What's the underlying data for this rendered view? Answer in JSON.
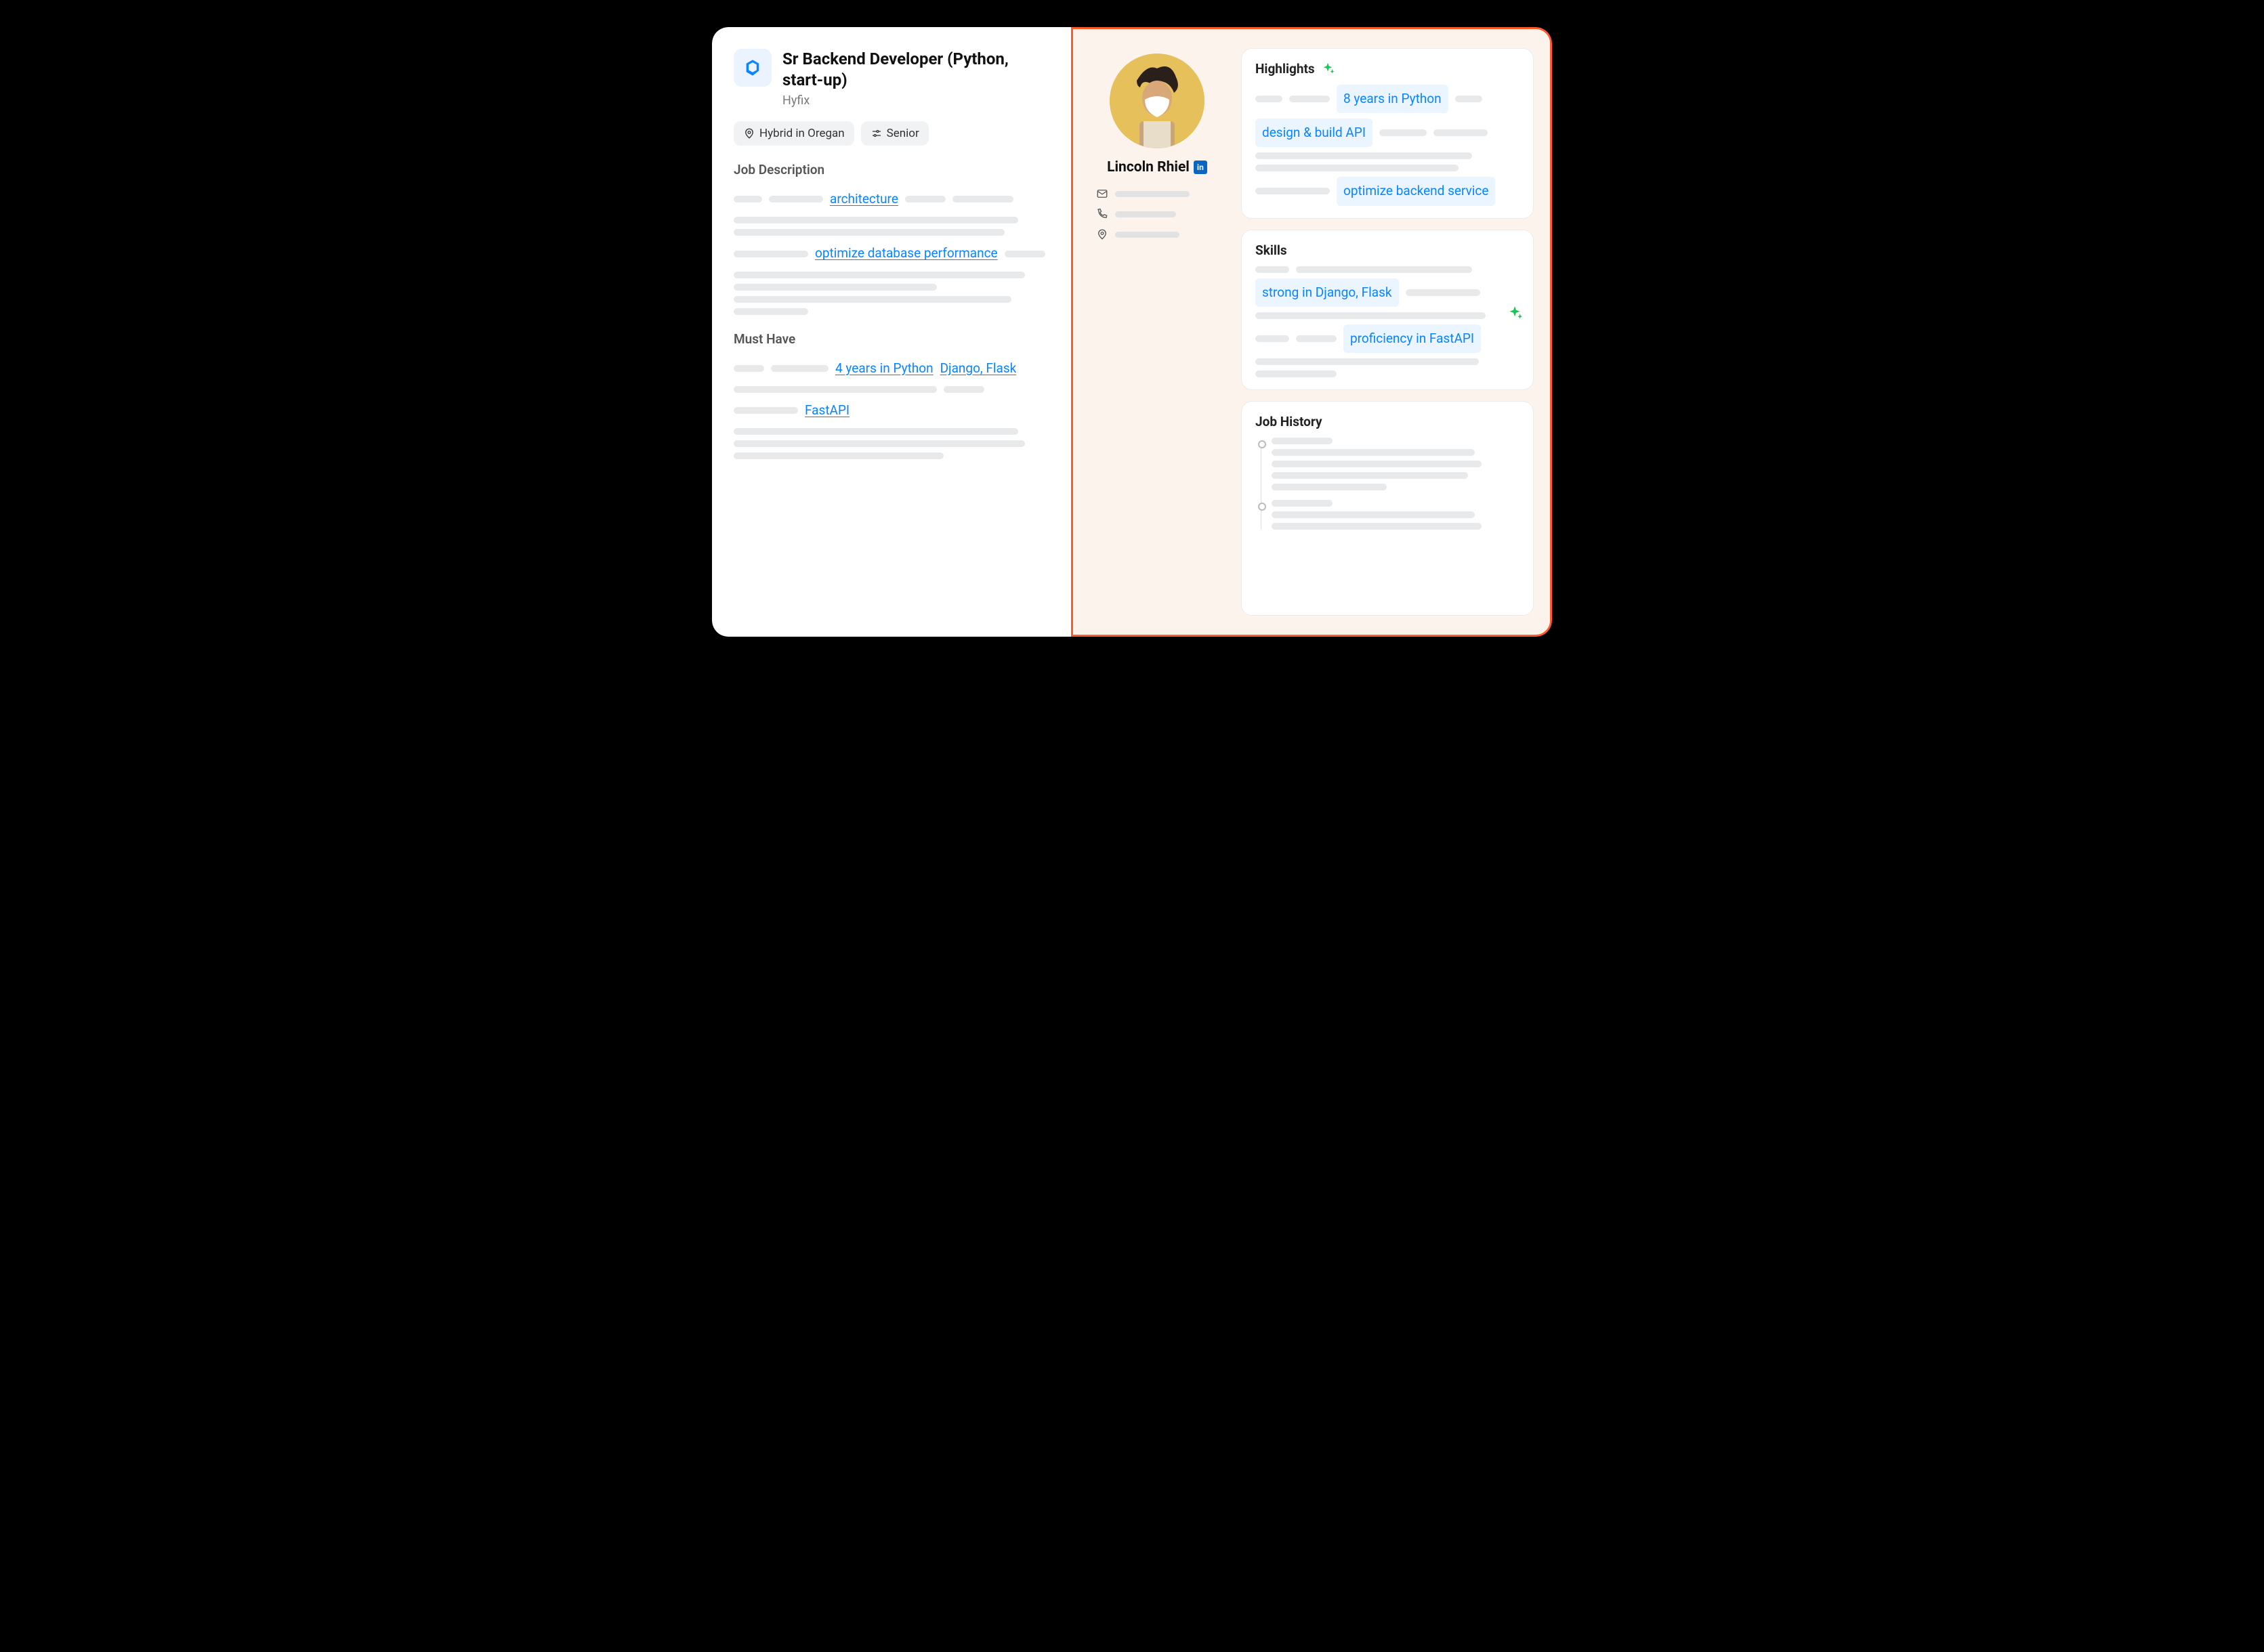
{
  "job": {
    "title": "Sr Backend Developer (Python, start-up)",
    "company": "Hyfix",
    "location_pill": "Hybrid in Oregan",
    "level_pill": "Senior",
    "sections": {
      "description": {
        "heading": "Job Description",
        "links": {
          "architecture": "architecture",
          "optimize_db": "optimize database performance"
        }
      },
      "must_have": {
        "heading": "Must Have",
        "links": {
          "years_python": "4 years in Python",
          "django_flask": "Django, Flask",
          "fastapi": "FastAPI"
        }
      }
    }
  },
  "candidate": {
    "name": "Lincoln Rhiel",
    "linkedin_label": "in",
    "highlights": {
      "heading": "Highlights",
      "chips": {
        "years_python": "8 years in Python",
        "design_api": "design & build API",
        "optimize_backend": "optimize backend service"
      }
    },
    "skills": {
      "heading": "Skills",
      "chips": {
        "django_flask": "strong in Django, Flask",
        "fastapi": "proficiency in FastAPI"
      }
    },
    "job_history": {
      "heading": "Job History"
    }
  }
}
